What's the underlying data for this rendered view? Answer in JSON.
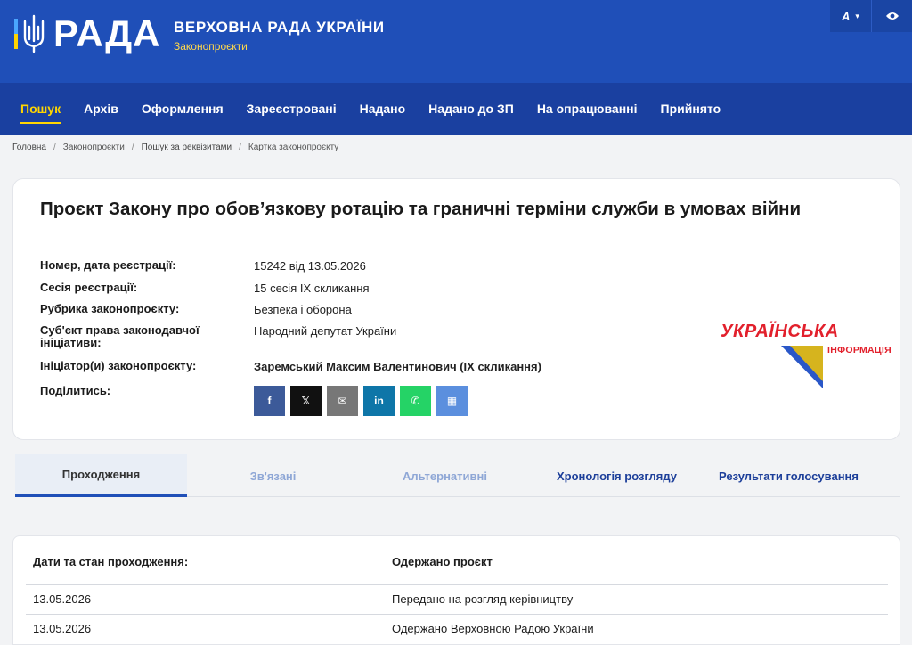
{
  "header": {
    "logo": "РАДА",
    "title": "ВЕРХОВНА РАДА УКРАЇНИ",
    "subtitle": "Законопроєкти",
    "font_button": "A",
    "colors": {
      "primary": "#1f4fb8",
      "accent": "#ffd500"
    }
  },
  "nav": {
    "items": [
      {
        "label": "Пошук",
        "active": true
      },
      {
        "label": "Архів"
      },
      {
        "label": "Оформлення"
      },
      {
        "label": "Зареєстровані"
      },
      {
        "label": "Надано"
      },
      {
        "label": "Надано до ЗП"
      },
      {
        "label": "На опрацюванні"
      },
      {
        "label": "Прийнято"
      }
    ]
  },
  "breadcrumb": [
    "Головна",
    "Законопроєкти",
    "Пошук за реквізитами",
    "Картка законопроєкту"
  ],
  "bill": {
    "title": "Проєкт Закону про обов’язкову ротацію та граничні терміни служби в умовах війни",
    "fields": [
      {
        "label": "Номер, дата реєстрації:",
        "value": "15242 від 13.05.2026"
      },
      {
        "label": "Сесія реєстрації:",
        "value": "15 сесія IX скликання"
      },
      {
        "label": "Рубрика законопроєкту:",
        "value": "Безпека і оборона"
      },
      {
        "label": "Суб'єкт права законодавчої ініціативи:",
        "value": "Народний депутат України"
      },
      {
        "label": "Ініціатор(и) законопроєкту:",
        "value": "Заремський Максим Валентинович (IX скликання)"
      },
      {
        "label": "Поділитись:"
      }
    ],
    "share_buttons": [
      {
        "icon": "facebook-icon",
        "glyph": "f"
      },
      {
        "icon": "x-icon",
        "glyph": "𝕏"
      },
      {
        "icon": "mail-icon",
        "glyph": "✉"
      },
      {
        "icon": "linkedin-icon",
        "glyph": "in"
      },
      {
        "icon": "whatsapp-icon",
        "glyph": "✆"
      },
      {
        "icon": "qr-code-icon",
        "glyph": "▦"
      }
    ]
  },
  "watermark": {
    "line1": "УКРАЇНСЬКА",
    "line2": "ІНФОРМАЦІЯ"
  },
  "tabs": [
    {
      "label": "Проходження",
      "state": "active"
    },
    {
      "label": "Зв'язані",
      "state": "muted"
    },
    {
      "label": "Альтернативні",
      "state": "muted"
    },
    {
      "label": "Хронологія розгляду",
      "state": "link"
    },
    {
      "label": "Результати голосування",
      "state": "link"
    }
  ],
  "table": {
    "headers": [
      "Дати та стан проходження:",
      "Одержано проєкт"
    ],
    "rows": [
      [
        "13.05.2026",
        "Передано на розгляд керівництву"
      ],
      [
        "13.05.2026",
        "Одержано Верховною Радою України"
      ]
    ]
  }
}
